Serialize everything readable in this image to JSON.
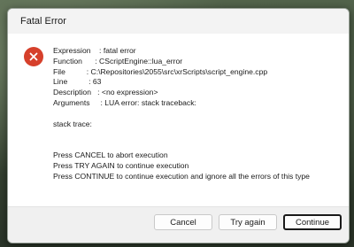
{
  "window": {
    "title": "Fatal Error"
  },
  "icon": "error-x-icon",
  "colors": {
    "error_red": "#d6402b",
    "default_button_border": "#1a1a1a"
  },
  "message": {
    "expression": "Expression    : fatal error",
    "function": "Function      : CScriptEngine::lua_error",
    "file": "File          : C:\\Repositories\\2055\\src\\xrScripts\\script_engine.cpp",
    "line": "Line          : 63",
    "description": "Description   : <no expression>",
    "arguments": "Arguments     : LUA error: stack traceback:",
    "stack_trace": "stack trace:",
    "instr_cancel": "Press CANCEL to abort execution",
    "instr_retry": "Press TRY AGAIN to continue execution",
    "instr_continue": "Press CONTINUE to continue execution and ignore all the errors of this type"
  },
  "buttons": {
    "cancel": "Cancel",
    "try_again": "Try again",
    "continue": "Continue"
  }
}
